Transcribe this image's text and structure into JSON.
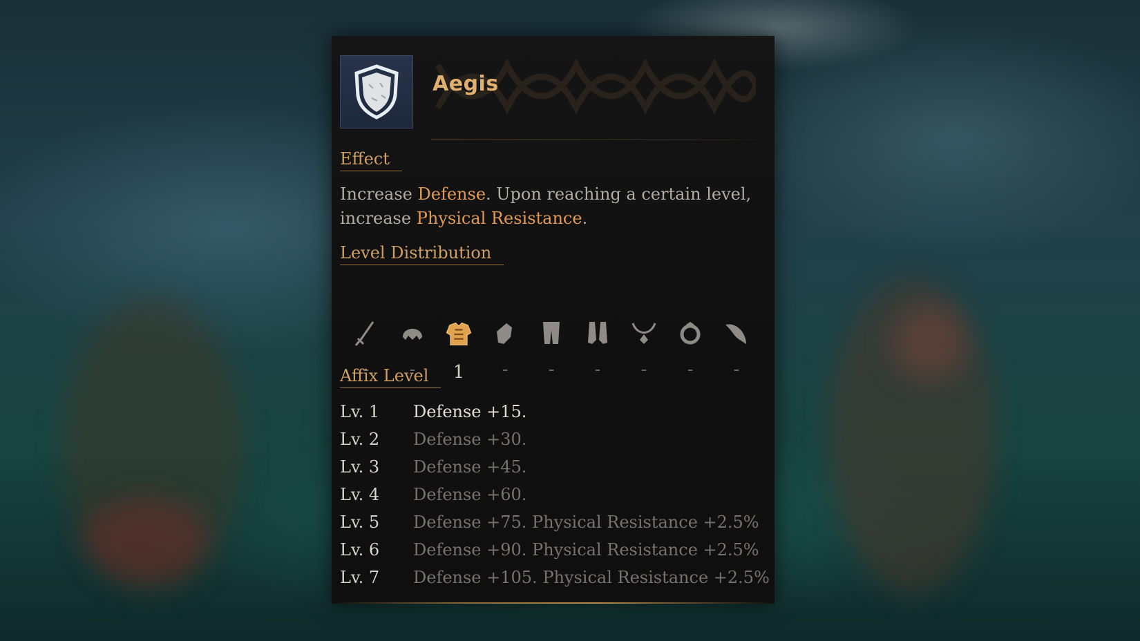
{
  "tooltip": {
    "title": "Aegis",
    "icon": "shield-icon",
    "effect_label": "Effect",
    "effect": {
      "p1": "Increase ",
      "h1": "Defense",
      "p2": ". Upon reaching a certain level,",
      "p3": "increase ",
      "h2": "Physical Resistance",
      "p4": "."
    },
    "distribution_label": "Level Distribution",
    "slots": [
      {
        "icon": "weapon-icon",
        "value": "-"
      },
      {
        "icon": "helmet-icon",
        "value": "-"
      },
      {
        "icon": "chest-armor-icon",
        "value": "1",
        "active": true
      },
      {
        "icon": "gloves-icon",
        "value": "-"
      },
      {
        "icon": "legs-icon",
        "value": "-"
      },
      {
        "icon": "boots-icon",
        "value": "-"
      },
      {
        "icon": "necklace-icon",
        "value": "-"
      },
      {
        "icon": "ring-icon",
        "value": "-"
      },
      {
        "icon": "horn-icon",
        "value": "-"
      }
    ],
    "affix_label": "Affix Level",
    "affix_levels": [
      {
        "level": "Lv. 1",
        "text": "Defense +15."
      },
      {
        "level": "Lv. 2",
        "text": "Defense +30."
      },
      {
        "level": "Lv. 3",
        "text": "Defense +45."
      },
      {
        "level": "Lv. 4",
        "text": "Defense +60."
      },
      {
        "level": "Lv. 5",
        "text": "Defense +75. Physical Resistance +2.5%"
      },
      {
        "level": "Lv. 6",
        "text": "Defense +90. Physical Resistance +2.5%"
      },
      {
        "level": "Lv. 7",
        "text": "Defense +105. Physical Resistance +2.5%"
      }
    ],
    "current_level": 1,
    "colors": {
      "title": "#e0b071",
      "highlight": "#e29a52",
      "section": "#cf9f62",
      "active_slot": "#e0a24e"
    }
  }
}
